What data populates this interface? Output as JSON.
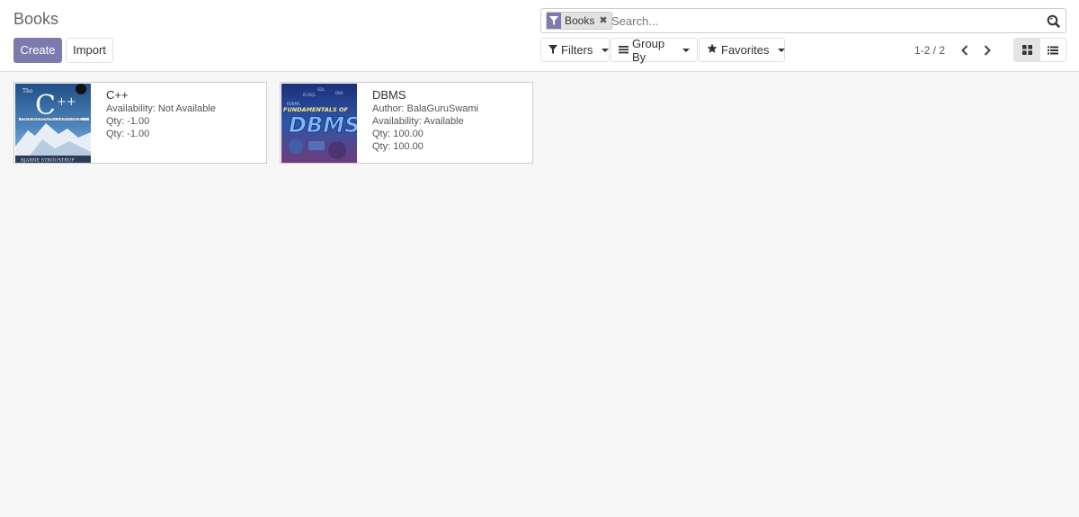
{
  "header": {
    "title": "Books",
    "create_label": "Create",
    "import_label": "Import"
  },
  "search": {
    "facet_value": "Books",
    "facet_icon": "filter-icon",
    "placeholder": "Search...",
    "search_icon": "magnifier-icon"
  },
  "toolbar": {
    "filters_label": "Filters",
    "group_by_label": "Group By",
    "favorites_label": "Favorites"
  },
  "pager": {
    "value": "1-2 / 2"
  },
  "colors": {
    "accent": "#7c7bad",
    "background": "#f6f6f6"
  },
  "cards": [
    {
      "title": "C++",
      "cover_alt": "The C++ Programming Language",
      "lines": [
        "Availability: Not Available",
        "Qty: -1.00",
        "Qty: -1.00"
      ]
    },
    {
      "title": "DBMS",
      "cover_alt": "Fundamentals of DBMS",
      "lines": [
        "Author: BalaGuruSwami",
        "Availability: Available",
        "Qty: 100.00",
        "Qty: 100.00"
      ]
    }
  ]
}
